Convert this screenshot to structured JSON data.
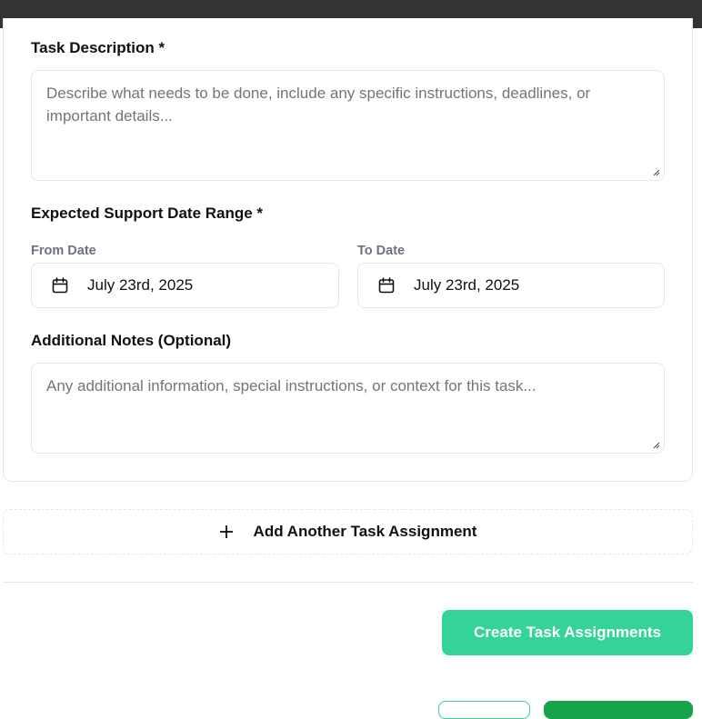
{
  "form": {
    "task_description": {
      "label": "Task Description *",
      "placeholder": "Describe what needs to be done, include any specific instructions, deadlines, or important details..."
    },
    "date_range": {
      "label": "Expected Support Date Range *",
      "from": {
        "label": "From Date",
        "value": "July 23rd, 2025",
        "icon": "calendar-icon"
      },
      "to": {
        "label": "To Date",
        "value": "July 23rd, 2025",
        "icon": "calendar-icon"
      }
    },
    "notes": {
      "label": "Additional Notes (Optional)",
      "placeholder": "Any additional information, special instructions, or context for this task..."
    }
  },
  "actions": {
    "add_another": {
      "label": "Add Another Task Assignment",
      "icon": "plus-icon"
    },
    "create": {
      "label": "Create Task Assignments"
    }
  },
  "colors": {
    "accent": "#34d399",
    "accent_dark": "#16a34a",
    "topbar": "#333333",
    "border": "#e5e7eb"
  }
}
